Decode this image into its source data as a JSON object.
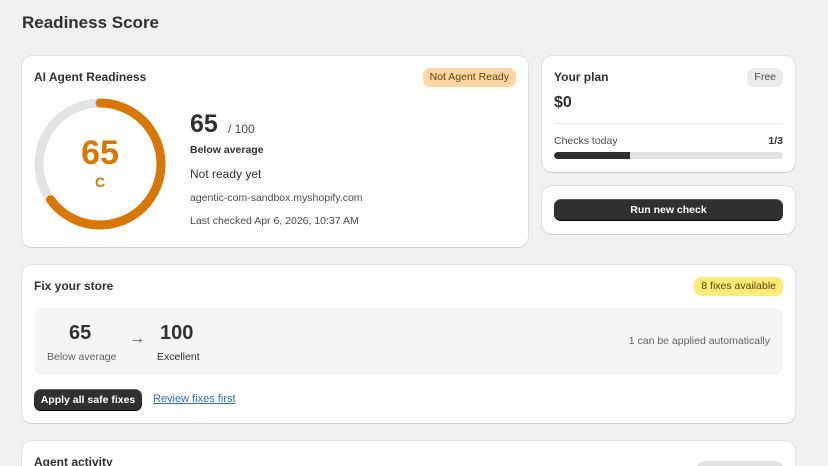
{
  "page": {
    "title": "Readiness Score"
  },
  "readiness": {
    "title": "AI Agent Readiness",
    "status_badge": "Not Agent Ready",
    "score": "65",
    "score_value": 65,
    "grade": "C",
    "out_of": "/ 100",
    "score_label": "Below average",
    "ready_text": "Not ready yet",
    "domain": "agentic-com-sandbox.myshopify.com",
    "last_checked": "Last checked Apr 6, 2026, 10:37 AM",
    "gauge_color": "#d97706",
    "gauge_track_color": "#e3e3e3"
  },
  "plan": {
    "title": "Your plan",
    "badge": "Free",
    "price": "$0",
    "checks_label": "Checks today",
    "checks_count": "1/3",
    "checks_fraction": 0.333
  },
  "run": {
    "button_label": "Run new check"
  },
  "fix": {
    "title": "Fix your store",
    "badge": "8 fixes available",
    "from_score": "65",
    "from_label": "Below average",
    "arrow": "→",
    "to_score": "100",
    "to_label": "Excellent",
    "auto_text": "1 can be applied automatically",
    "apply_label": "Apply all safe fixes",
    "review_label": "Review fixes first"
  },
  "activity": {
    "title": "Agent activity"
  }
}
